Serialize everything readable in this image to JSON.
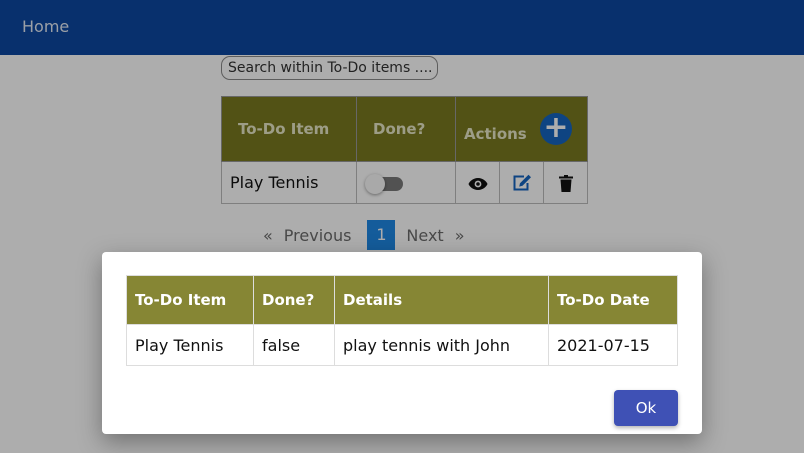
{
  "navbar": {
    "home_label": "Home"
  },
  "search": {
    "placeholder": "Search within To-Do items ...."
  },
  "todo_table": {
    "headers": {
      "item": "To-Do Item",
      "done": "Done?",
      "actions": "Actions"
    },
    "rows": [
      {
        "item": "Play Tennis",
        "done": false
      }
    ],
    "icons": {
      "add": "plus-circle-icon",
      "view": "eye-icon",
      "edit": "edit-icon",
      "delete": "trash-icon"
    },
    "add_symbol": "+"
  },
  "pagination": {
    "prev_chevron": "«",
    "previous": "Previous",
    "current": "1",
    "next": "Next",
    "next_chevron": "»"
  },
  "modal": {
    "headers": {
      "item": "To-Do Item",
      "done": "Done?",
      "details": "Details",
      "date": "To-Do Date"
    },
    "row": {
      "item": "Play Tennis",
      "done": "false",
      "details": "play tennis with John",
      "date": "2021-07-15"
    },
    "ok_label": "Ok"
  },
  "colors": {
    "navbar": "#0d47a1",
    "table_header": "#7a7a20",
    "modal_header": "#868634",
    "primary_button": "#3f51b5",
    "page_active": "#1e88e5"
  }
}
